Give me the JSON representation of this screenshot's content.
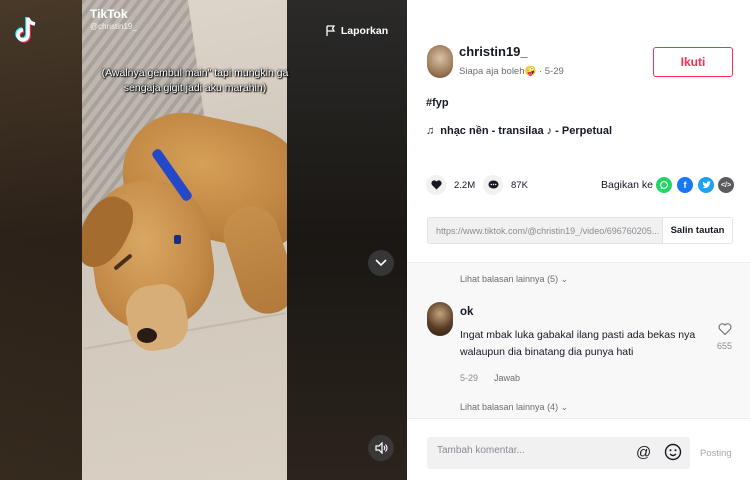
{
  "video": {
    "watermark_app": "TikTok",
    "watermark_user": "@christin19_",
    "caption_overlay": "(Awalnya gembul main\" tapi mungkin ga sengaja gigit jadi aku marahin)",
    "report_label": "Laporkan"
  },
  "author": {
    "username": "christin19_",
    "subline": "Siapa aja boleh🤪 · 5-29",
    "follow_label": "Ikuti"
  },
  "post": {
    "hashtag": "#fyp",
    "music_note": "♫",
    "music": "nhạc nền - transilaa ♪ - Perpetual"
  },
  "stats": {
    "likes": "2.2M",
    "comments": "87K"
  },
  "share": {
    "label": "Bagikan ke"
  },
  "link": {
    "url": "https://www.tiktok.com/@christin19_/video/696760205...",
    "copy_label": "Salin tautan"
  },
  "comments": {
    "more_replies_top": "Lihat balasan lainnya (5)",
    "item": {
      "name": "ok",
      "text": "Ingat mbak luka gabakal ilang pasti ada bekas nya walaupun dia binatang dia punya hati",
      "date": "5-29",
      "reply_label": "Jawab",
      "likes": "655"
    },
    "more_replies_bottom": "Lihat balasan lainnya (4)"
  },
  "composer": {
    "placeholder": "Tambah komentar...",
    "post_label": "Posting"
  },
  "colors": {
    "accent": "#fe2c55",
    "whatsapp": "#25d366",
    "facebook": "#1877f2",
    "twitter": "#1da1f2"
  }
}
